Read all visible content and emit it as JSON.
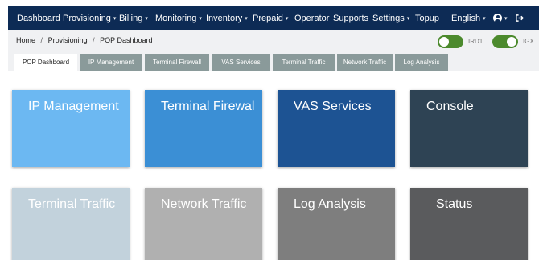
{
  "nav": {
    "dashboard": "Dashboard",
    "provisioning": "Provisioning",
    "billing": "Billing",
    "monitoring": "Monitoring",
    "inventory": "Inventory",
    "prepaid": "Prepaid",
    "operator": "Operator",
    "supports": "Supports",
    "settings": "Settings",
    "topup": "Topup",
    "language": "English",
    "caret": "▾"
  },
  "breadcrumb": [
    "Home",
    "Provisioning",
    "POP Dashboard"
  ],
  "breadcrumb_sep": "/",
  "toggles": [
    {
      "label": "IRD1",
      "on": true
    },
    {
      "label": "IGX",
      "on": true
    }
  ],
  "tabs": [
    "POP Dashboard",
    "IP Management",
    "Terminal Firewall",
    "VAS Services",
    "Terminal Traffic",
    "Network Traffic",
    "Log Analysis"
  ],
  "tiles": [
    {
      "label": "IP Management",
      "color": "#6cb8f2"
    },
    {
      "label": "Terminal Firewal",
      "color": "#3b8fd5"
    },
    {
      "label": "VAS Services",
      "color": "#1d5393"
    },
    {
      "label": "Console",
      "color": "#2e4354"
    },
    {
      "label": "Terminal Traffic",
      "color": "#c2d2dc"
    },
    {
      "label": "Network Traffic",
      "color": "#b0b0b0"
    },
    {
      "label": "Log Analysis",
      "color": "#7e7e7e"
    },
    {
      "label": "Status",
      "color": "#5a5b5d"
    }
  ],
  "colors": {
    "navbar": "#0d2b55",
    "subbar": "#f0f1f3",
    "tab": "#8a9a9a",
    "toggle_on": "#4c8a2d"
  }
}
